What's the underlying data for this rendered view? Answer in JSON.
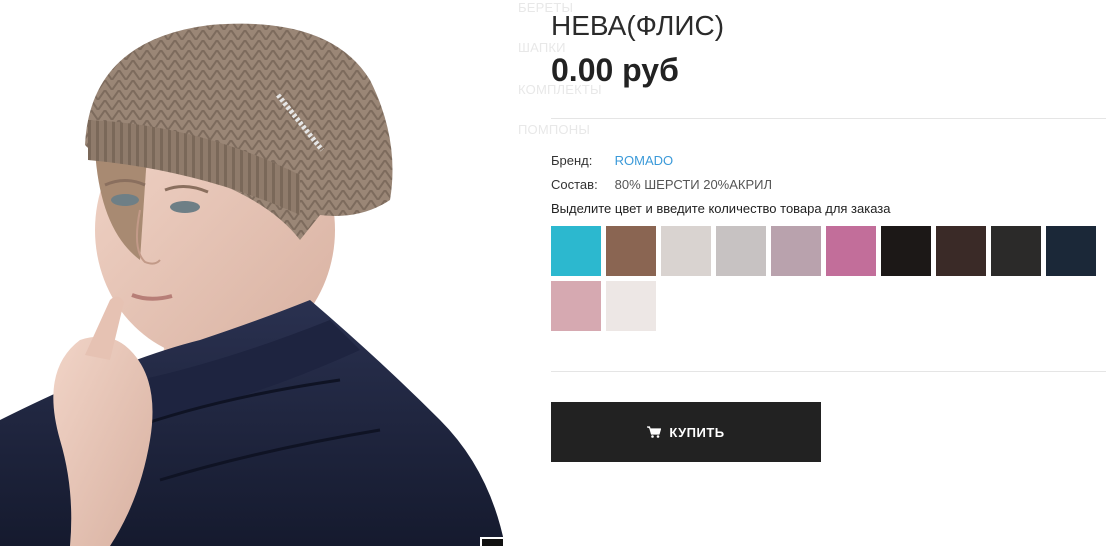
{
  "background_nav": [
    "БЕРЕТЫ",
    "ШАПКИ",
    "КОМПЛЕКТЫ",
    "ПОМПОНЫ"
  ],
  "product": {
    "title": "НЕВА(ФЛИС)",
    "price": "0.00 руб",
    "brand_label": "Бренд:",
    "brand_value": "ROMADO",
    "composition_label": "Состав:",
    "composition_value": "80% ШЕРСТИ 20%АКРИЛ",
    "color_hint": "Выделите цвет и введите количество товара для заказа"
  },
  "swatches": [
    {
      "color": "#2cb8cf"
    },
    {
      "color": "#8a6552"
    },
    {
      "color": "#d9d3d0"
    },
    {
      "color": "#c7c2c2"
    },
    {
      "color": "#b9a2ad"
    },
    {
      "color": "#c26e9a"
    },
    {
      "color": "#1c1817"
    },
    {
      "color": "#3a2a27"
    },
    {
      "color": "#2b2a29"
    },
    {
      "color": "#1b2838"
    },
    {
      "color": "#d6a9b1"
    },
    {
      "color": "#ede7e5"
    }
  ],
  "buy_button": {
    "label": "КУПИТЬ",
    "icon": "cart-icon"
  },
  "colors": {
    "accent_link": "#3b9ad9",
    "button_bg": "#222222"
  }
}
